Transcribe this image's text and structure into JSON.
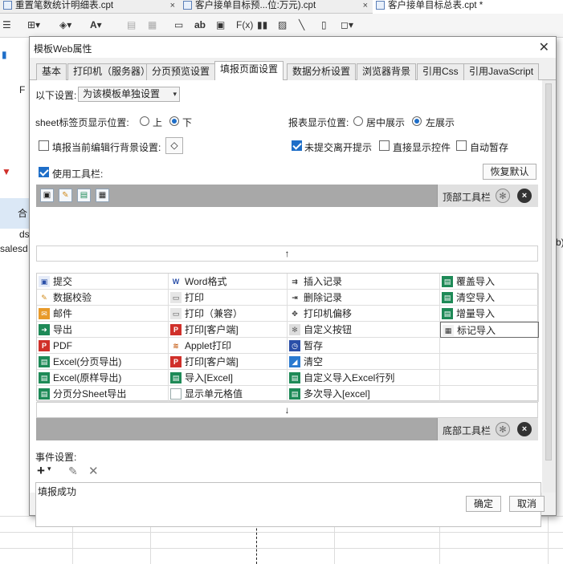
{
  "app": {
    "tabs": [
      {
        "label": "重置笔数统计明细表.cpt",
        "close": "×"
      },
      {
        "label": "客户接单目标预...位:万元).cpt",
        "close": "×"
      },
      {
        "label": "客户接单目标总表.cpt *",
        "close": "×"
      }
    ],
    "toolbar": {
      "text_tool": "ab",
      "formula_tool": "F(x)"
    },
    "sheet": {
      "col_header_fragment": "F",
      "cell_a": "合",
      "cell_b": "ds",
      "cell_c": "salesd",
      "right_fragment": "b)"
    }
  },
  "dialog": {
    "title": "模板Web属性",
    "close": "✕",
    "tabs": [
      "基本",
      "打印机（服务器）",
      "分页预览设置",
      "填报页面设置",
      "数据分析设置",
      "浏览器背景",
      "引用Css",
      "引用JavaScript"
    ],
    "active_tab_index": 3,
    "settings": {
      "scope_label": "以下设置:",
      "scope_value": "为该模板单独设置",
      "sheet_tab_label": "sheet标签页显示位置:",
      "sheet_tab_options": [
        "上",
        "下"
      ],
      "sheet_tab_selected": "下",
      "report_pos_label": "报表显示位置:",
      "report_pos_options": [
        "居中展示",
        "左展示"
      ],
      "report_pos_selected": "左展示",
      "fill_bg_label": "填报当前编辑行背景设置:",
      "fill_bg_checked": false,
      "unsubmitted_label": "未提交离开提示",
      "unsubmitted_checked": true,
      "direct_controls_label": "直接显示控件",
      "direct_controls_checked": false,
      "autosave_label": "自动暂存",
      "autosave_checked": false,
      "use_toolbar_label": "使用工具栏:",
      "use_toolbar_checked": true,
      "restore_default": "恢复默认"
    },
    "top_toolbar_label": "顶部工具栏",
    "bottom_toolbar_label": "底部工具栏",
    "up_arrow": "↑",
    "down_arrow": "↓",
    "button_grid": [
      [
        {
          "label": "提交",
          "icon": "save-icon"
        },
        {
          "label": "Word格式",
          "icon": "word-icon"
        },
        {
          "label": "插入记录",
          "icon": "insert-record-icon"
        },
        {
          "label": "覆盖导入",
          "icon": "excel-icon"
        }
      ],
      [
        {
          "label": "数据校验",
          "icon": "pencil-icon"
        },
        {
          "label": "打印",
          "icon": "printer-icon"
        },
        {
          "label": "删除记录",
          "icon": "delete-record-icon"
        },
        {
          "label": "清空导入",
          "icon": "excel-icon"
        }
      ],
      [
        {
          "label": "邮件",
          "icon": "mail-icon"
        },
        {
          "label": "打印（兼容）",
          "icon": "printer-icon"
        },
        {
          "label": "打印机偏移",
          "icon": "move-icon"
        },
        {
          "label": "增量导入",
          "icon": "excel-icon"
        }
      ],
      [
        {
          "label": "导出",
          "icon": "export-icon"
        },
        {
          "label": "打印[客户端]",
          "icon": "pdf-print-icon"
        },
        {
          "label": "自定义按钮",
          "icon": "gear-icon"
        },
        {
          "label": "标记导入",
          "icon": "mark-import-icon"
        }
      ],
      [
        {
          "label": "PDF",
          "icon": "pdf-icon"
        },
        {
          "label": "Applet打印",
          "icon": "applet-icon"
        },
        {
          "label": "暂存",
          "icon": "temp-save-icon"
        },
        {
          "label": "",
          "icon": ""
        }
      ],
      [
        {
          "label": "Excel(分页导出)",
          "icon": "excel-icon"
        },
        {
          "label": "打印[客户端]",
          "icon": "pdf-icon"
        },
        {
          "label": "清空",
          "icon": "eraser-icon"
        },
        {
          "label": "",
          "icon": ""
        }
      ],
      [
        {
          "label": "Excel(原样导出)",
          "icon": "excel-icon"
        },
        {
          "label": "导入[Excel]",
          "icon": "excel-icon"
        },
        {
          "label": "自定义导入Excel行列",
          "icon": "excel-icon"
        },
        {
          "label": "",
          "icon": ""
        }
      ],
      [
        {
          "label": "分页分Sheet导出",
          "icon": "excel-icon"
        },
        {
          "label": "显示单元格值",
          "icon": "blank-icon"
        },
        {
          "label": "多次导入[excel]",
          "icon": "excel-icon"
        },
        {
          "label": "",
          "icon": ""
        }
      ]
    ],
    "selected_cell": [
      3,
      3
    ],
    "events_label": "事件设置:",
    "events": [
      "填报成功"
    ],
    "ok": "确定",
    "cancel": "取消"
  },
  "colors": {
    "accent": "#1e6ec8",
    "excel_green": "#1e8a57",
    "pdf_red": "#d0302a"
  }
}
